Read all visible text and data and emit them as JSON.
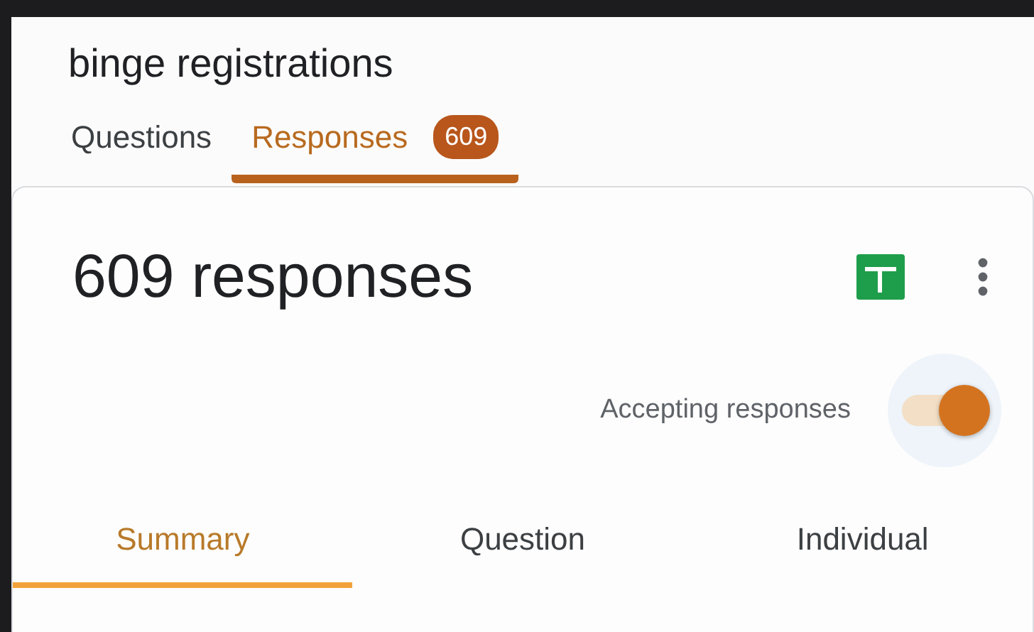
{
  "form_title": "binge registrations",
  "tabs": [
    {
      "label": "Questions",
      "selected": false
    },
    {
      "label": "Responses",
      "selected": true,
      "badge": "609"
    }
  ],
  "responses_card": {
    "heading": "609 responses",
    "accepting": {
      "label": "Accepting responses",
      "on": true
    },
    "view_tabs": [
      {
        "label": "Summary",
        "selected": true
      },
      {
        "label": "Question",
        "selected": false
      },
      {
        "label": "Individual",
        "selected": false
      }
    ]
  }
}
